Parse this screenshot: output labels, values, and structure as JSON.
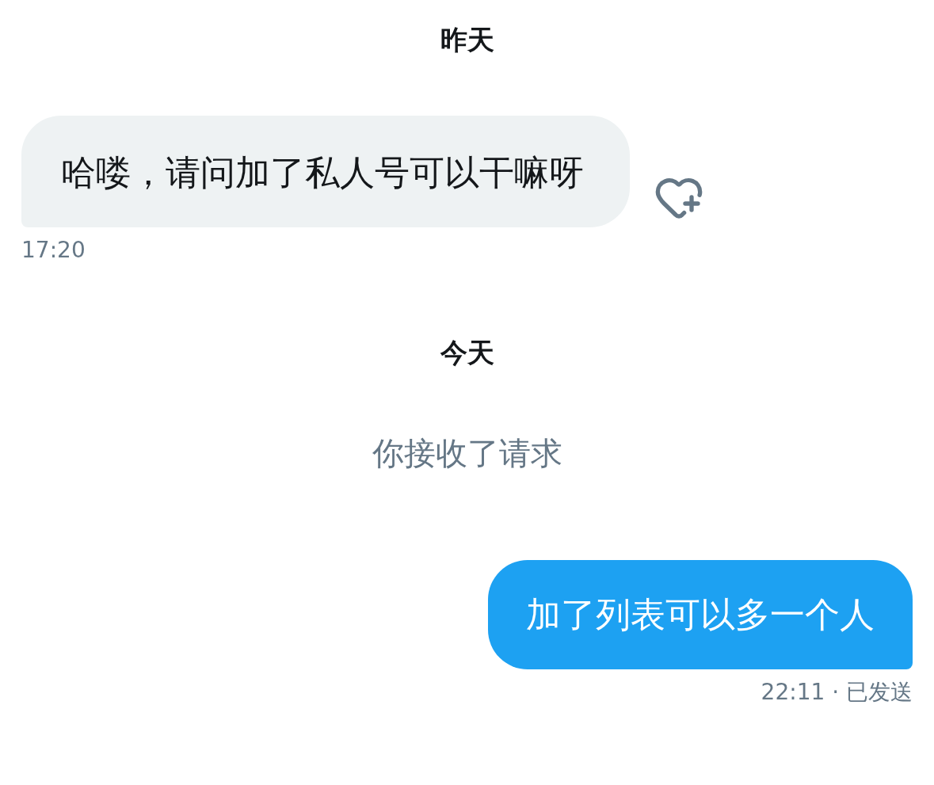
{
  "messages": [
    {
      "kind": "date",
      "text": "昨天"
    },
    {
      "kind": "incoming",
      "text": "哈喽，请问加了私人号可以干嘛呀",
      "time": "17:20"
    },
    {
      "kind": "date",
      "text": "今天"
    },
    {
      "kind": "system",
      "text": "你接收了请求"
    },
    {
      "kind": "outgoing",
      "text": "加了列表可以多一个人",
      "meta": "22:11 · 已发送"
    }
  ]
}
